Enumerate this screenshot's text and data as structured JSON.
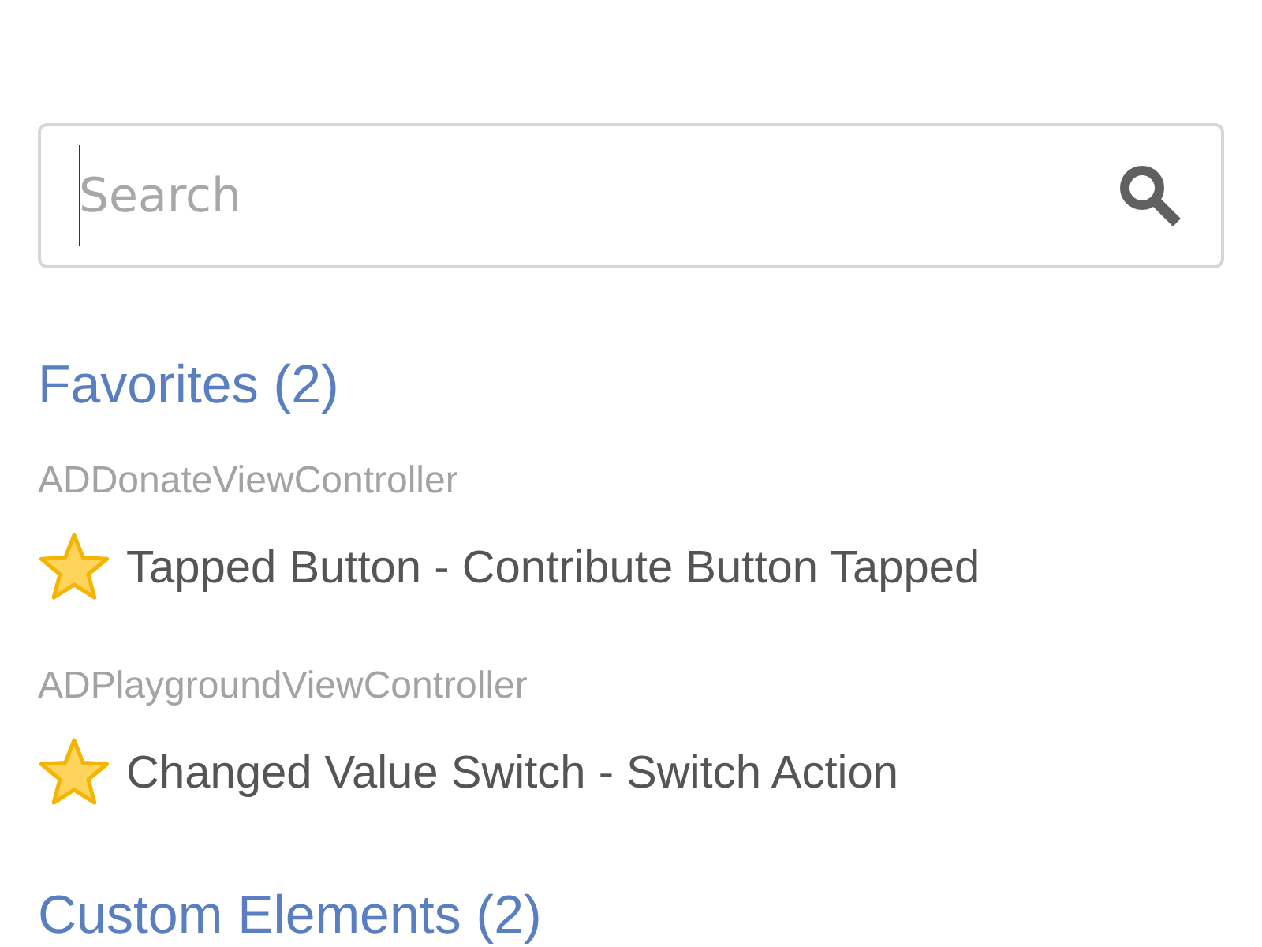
{
  "search": {
    "placeholder": "Search",
    "focused": true
  },
  "sections": [
    {
      "title": "Favorites (2)",
      "groups": [
        {
          "controller": "ADDonateViewController",
          "events": [
            {
              "label": "Tapped Button - Contribute Button Tapped",
              "favorite": true
            }
          ]
        },
        {
          "controller": "ADPlaygroundViewController",
          "events": [
            {
              "label": "Changed Value Switch - Switch Action",
              "favorite": true
            }
          ]
        }
      ]
    },
    {
      "title": "Custom Elements (2)"
    }
  ]
}
